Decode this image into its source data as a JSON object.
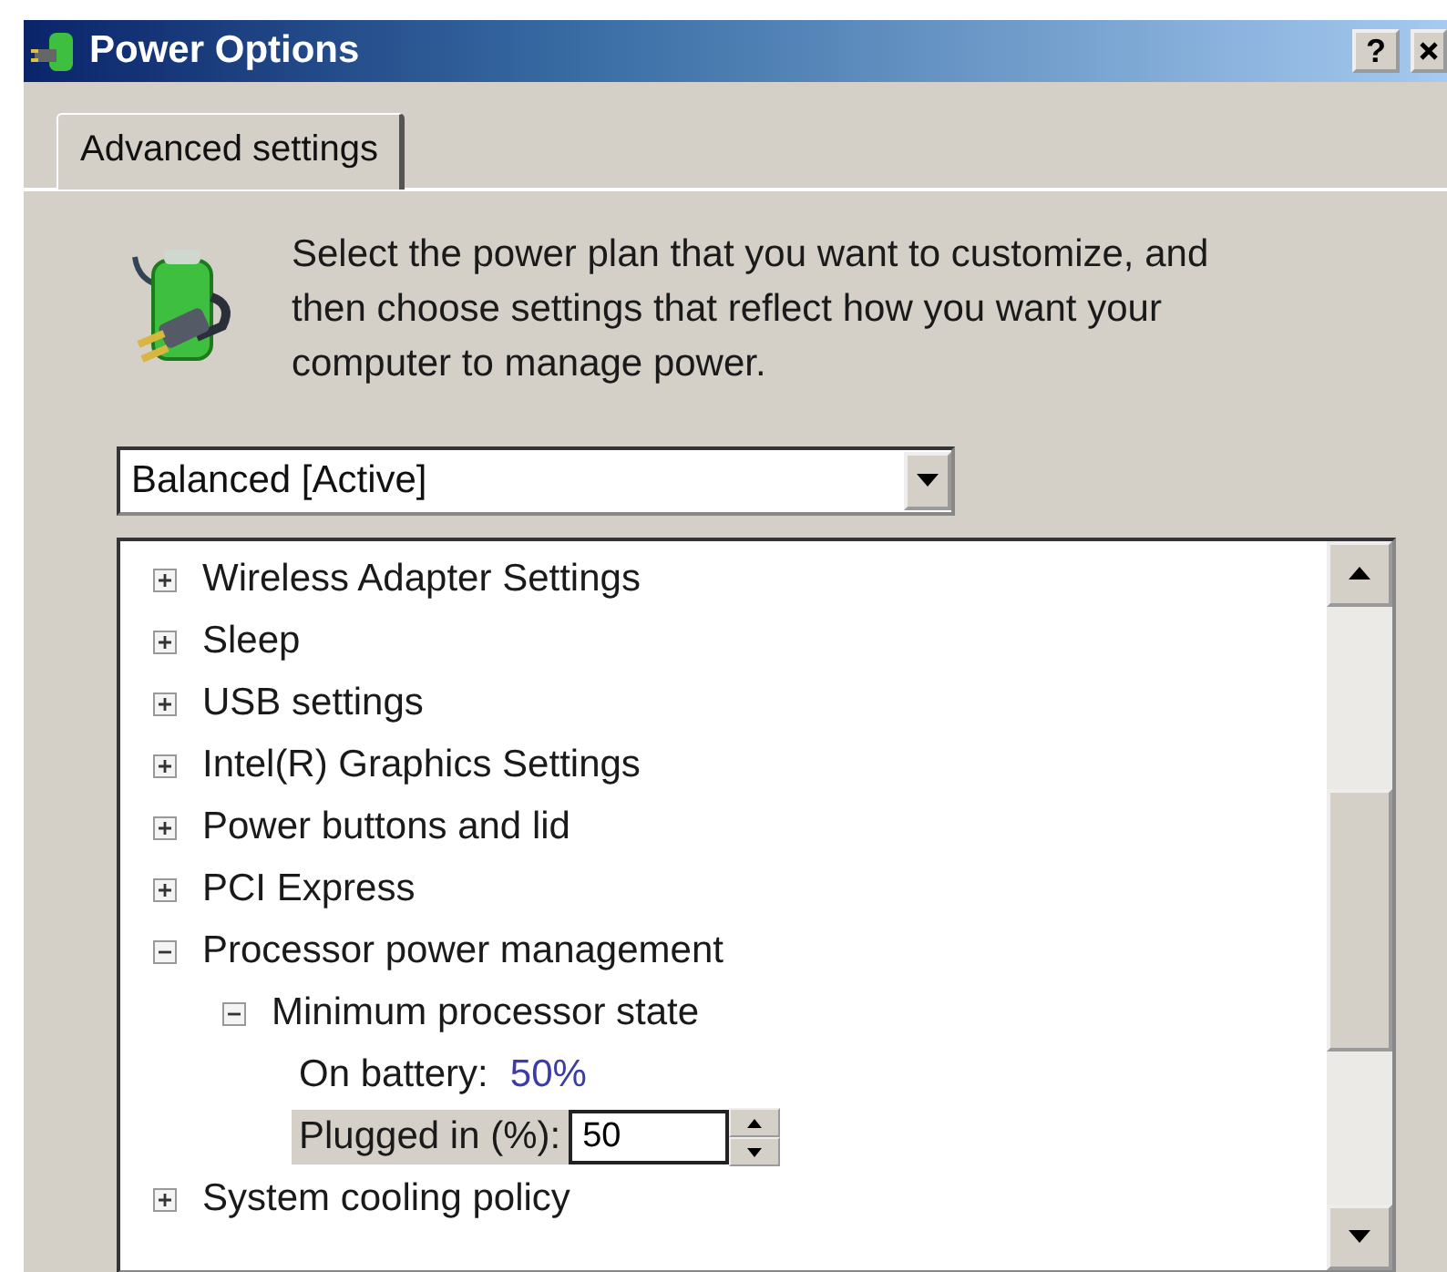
{
  "window": {
    "title": "Power Options",
    "buttons": [
      {
        "kind": "help",
        "label": "?"
      },
      {
        "kind": "close"
      }
    ]
  },
  "tabs": [
    {
      "label": "Advanced settings",
      "selected": true
    }
  ],
  "description": "Select the power plan that you want to customize, and then choose settings that reflect how you want your computer to manage power.",
  "plan_dropdown": {
    "value": "Balanced [Active]"
  },
  "settings_tree": [
    {
      "label": "Wireless Adapter Settings",
      "expanded": false
    },
    {
      "label": "Sleep",
      "expanded": false
    },
    {
      "label": "USB settings",
      "expanded": false
    },
    {
      "label": "Intel(R) Graphics Settings",
      "expanded": false
    },
    {
      "label": "Power buttons and lid",
      "expanded": false
    },
    {
      "label": "PCI Express",
      "expanded": false
    },
    {
      "label": "Processor power management",
      "expanded": true,
      "children": [
        {
          "label": "Minimum processor state",
          "expanded": true,
          "children": [
            {
              "kind": "value",
              "label": "On battery:",
              "value": "50%",
              "selected": false
            },
            {
              "kind": "spin",
              "label": "Plugged in (%):",
              "value": "50",
              "selected": true
            }
          ]
        }
      ]
    },
    {
      "label": "System cooling policy",
      "expanded": false
    }
  ]
}
